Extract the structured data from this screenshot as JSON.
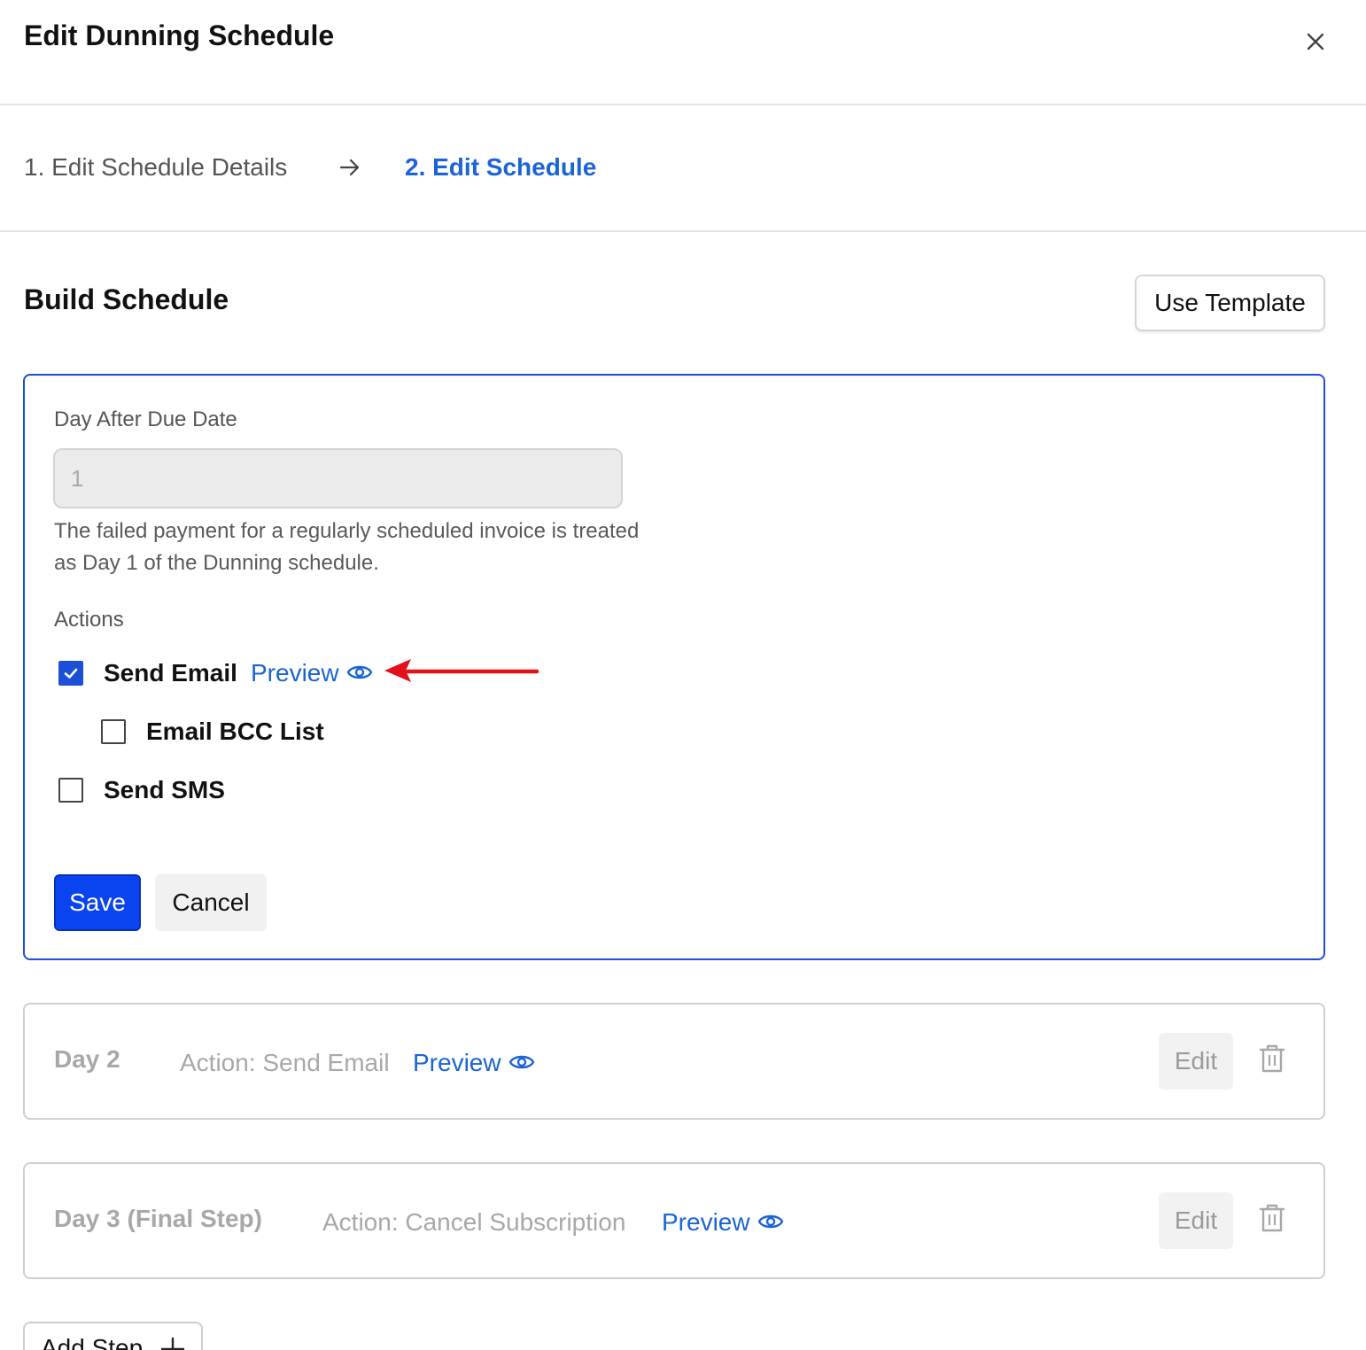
{
  "dialog": {
    "title": "Edit Dunning Schedule",
    "close_icon": "close-icon"
  },
  "steps": {
    "step1": "1. Edit Schedule Details",
    "step2": "2. Edit Schedule",
    "active_color": "#1a64d6"
  },
  "build": {
    "title": "Build Schedule",
    "use_template_label": "Use Template"
  },
  "active_step": {
    "field_label": "Day After Due Date",
    "day_value": "1",
    "help_text": "The failed payment for a regularly scheduled invoice is treated as Day 1 of the Dunning schedule.",
    "actions_label": "Actions",
    "send_email_label": "Send Email",
    "send_email_checked": true,
    "preview_label": "Preview",
    "bcc_label": "Email BCC List",
    "bcc_checked": false,
    "sms_label": "Send SMS",
    "sms_checked": false,
    "save_label": "Save",
    "cancel_label": "Cancel",
    "border_color": "#1c4fd8"
  },
  "schedule_steps": [
    {
      "day": "Day 2",
      "action": "Action: Send Email",
      "preview": "Preview",
      "edit": "Edit"
    },
    {
      "day": "Day 3 (Final Step)",
      "action": "Action: Cancel Subscription",
      "preview": "Preview",
      "edit": "Edit"
    }
  ],
  "add_step_label": "Add Step",
  "colors": {
    "primary_button": "#0a44f0",
    "link": "#1a64d6",
    "annotation_arrow": "#e3101a"
  }
}
